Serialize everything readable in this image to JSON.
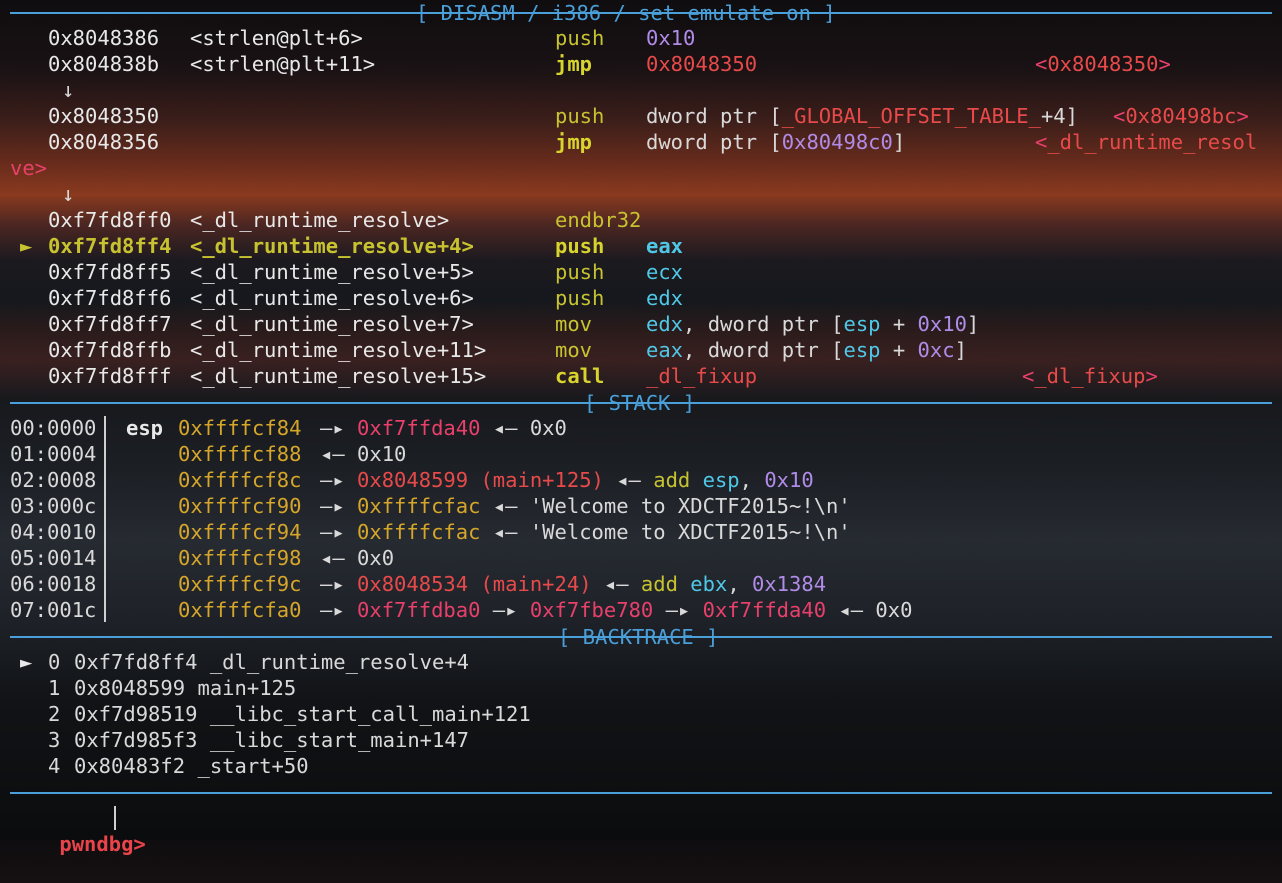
{
  "sections": {
    "disasm": "[ DISASM / i386 / set emulate on ]",
    "stack": "[ STACK ]",
    "backtrace": "[ BACKTRACE ]"
  },
  "disasm": [
    {
      "marker": "",
      "addr": "0x8048386",
      "sym": "<strlen@plt+6>",
      "op": "push",
      "args": "0x10",
      "comment": ""
    },
    {
      "marker": "",
      "addr": "0x804838b",
      "sym": "<strlen@plt+11>",
      "op": "jmp",
      "args": "0x8048350",
      "comment": "<0x8048350>"
    },
    {
      "arrow": "↓"
    },
    {
      "marker": "",
      "addr": "0x8048350",
      "sym": "",
      "op": "push",
      "args": "dword ptr [_GLOBAL_OFFSET_TABLE_+4]",
      "comment": "<0x80498bc>"
    },
    {
      "marker": "",
      "addr": "0x8048356",
      "sym": "",
      "op": "jmp",
      "args": "dword ptr [0x80498c0]",
      "comment": "<_dl_runtime_resol"
    },
    {
      "wrap": "ve>"
    },
    {
      "arrow": "↓"
    },
    {
      "marker": "",
      "addr": "0xf7fd8ff0",
      "sym": "<_dl_runtime_resolve>",
      "op": "endbr32",
      "args": "",
      "comment": ""
    },
    {
      "marker": "►",
      "addr": "0xf7fd8ff4",
      "sym": "<_dl_runtime_resolve+4>",
      "op": "push",
      "args": "eax",
      "comment": ""
    },
    {
      "marker": "",
      "addr": "0xf7fd8ff5",
      "sym": "<_dl_runtime_resolve+5>",
      "op": "push",
      "args": "ecx",
      "comment": ""
    },
    {
      "marker": "",
      "addr": "0xf7fd8ff6",
      "sym": "<_dl_runtime_resolve+6>",
      "op": "push",
      "args": "edx",
      "comment": ""
    },
    {
      "marker": "",
      "addr": "0xf7fd8ff7",
      "sym": "<_dl_runtime_resolve+7>",
      "op": "mov",
      "args": "edx, dword ptr [esp + 0x10]",
      "comment": ""
    },
    {
      "marker": "",
      "addr": "0xf7fd8ffb",
      "sym": "<_dl_runtime_resolve+11>",
      "op": "mov",
      "args": "eax, dword ptr [esp + 0xc]",
      "comment": ""
    },
    {
      "marker": "",
      "addr": "0xf7fd8fff",
      "sym": "<_dl_runtime_resolve+15>",
      "op": "call",
      "args": "_dl_fixup",
      "comment": "<_dl_fixup>"
    }
  ],
  "stack": [
    {
      "off": "00:0000",
      "reg": "esp",
      "addr": "0xffffcf84",
      "chain": [
        {
          "t": "—▸ ",
          "c": "gray"
        },
        {
          "t": "0xf7ffda40",
          "c": "pink"
        },
        {
          "t": " ◂— ",
          "c": "gray"
        },
        {
          "t": "0x0",
          "c": "gray"
        }
      ]
    },
    {
      "off": "01:0004",
      "reg": "",
      "addr": "0xffffcf88",
      "chain": [
        {
          "t": "◂— ",
          "c": "gray"
        },
        {
          "t": "0x10",
          "c": "gray"
        }
      ]
    },
    {
      "off": "02:0008",
      "reg": "",
      "addr": "0xffffcf8c",
      "chain": [
        {
          "t": "—▸ ",
          "c": "gray"
        },
        {
          "t": "0x8048599 (main+125)",
          "c": "red"
        },
        {
          "t": " ◂— ",
          "c": "gray"
        },
        {
          "t": "add ",
          "c": "op"
        },
        {
          "t": "esp",
          "c": "reg"
        },
        {
          "t": ", ",
          "c": "gray"
        },
        {
          "t": "0x10",
          "c": "num"
        }
      ]
    },
    {
      "off": "03:000c",
      "reg": "",
      "addr": "0xffffcf90",
      "chain": [
        {
          "t": "—▸ ",
          "c": "gray"
        },
        {
          "t": "0xffffcfac",
          "c": "stackaddr"
        },
        {
          "t": " ◂— ",
          "c": "gray"
        },
        {
          "t": "'Welcome to XDCTF2015~!\\n'",
          "c": "gray"
        }
      ]
    },
    {
      "off": "04:0010",
      "reg": "",
      "addr": "0xffffcf94",
      "chain": [
        {
          "t": "—▸ ",
          "c": "gray"
        },
        {
          "t": "0xffffcfac",
          "c": "stackaddr"
        },
        {
          "t": " ◂— ",
          "c": "gray"
        },
        {
          "t": "'Welcome to XDCTF2015~!\\n'",
          "c": "gray"
        }
      ]
    },
    {
      "off": "05:0014",
      "reg": "",
      "addr": "0xffffcf98",
      "chain": [
        {
          "t": "◂— ",
          "c": "gray"
        },
        {
          "t": "0x0",
          "c": "gray"
        }
      ]
    },
    {
      "off": "06:0018",
      "reg": "",
      "addr": "0xffffcf9c",
      "chain": [
        {
          "t": "—▸ ",
          "c": "gray"
        },
        {
          "t": "0x8048534 (main+24)",
          "c": "red"
        },
        {
          "t": " ◂— ",
          "c": "gray"
        },
        {
          "t": "add ",
          "c": "op"
        },
        {
          "t": "ebx",
          "c": "reg"
        },
        {
          "t": ", ",
          "c": "gray"
        },
        {
          "t": "0x1384",
          "c": "num"
        }
      ]
    },
    {
      "off": "07:001c",
      "reg": "",
      "addr": "0xffffcfa0",
      "chain": [
        {
          "t": "—▸ ",
          "c": "gray"
        },
        {
          "t": "0xf7ffdba0",
          "c": "pink"
        },
        {
          "t": " —▸ ",
          "c": "gray"
        },
        {
          "t": "0xf7fbe780",
          "c": "pink"
        },
        {
          "t": " —▸ ",
          "c": "gray"
        },
        {
          "t": "0xf7ffda40",
          "c": "pink"
        },
        {
          "t": " ◂— ",
          "c": "gray"
        },
        {
          "t": "0x0",
          "c": "gray"
        }
      ]
    }
  ],
  "backtrace": [
    {
      "marker": "►",
      "idx": "0",
      "addr": "0xf7fd8ff4",
      "sym": "_dl_runtime_resolve+4"
    },
    {
      "marker": "",
      "idx": "1",
      "addr": "0x8048599",
      "sym": "main+125"
    },
    {
      "marker": "",
      "idx": "2",
      "addr": "0xf7d98519",
      "sym": "__libc_start_call_main+121"
    },
    {
      "marker": "",
      "idx": "3",
      "addr": "0xf7d985f3",
      "sym": "__libc_start_main+147"
    },
    {
      "marker": "",
      "idx": "4",
      "addr": "0x80483f2",
      "sym": "_start+50"
    }
  ],
  "prompt": "pwndbg>",
  "colors": {
    "separator": "#4a9fd8",
    "current_line": "#c7c330",
    "opcode": "#c7c330",
    "register": "#4fc8e8",
    "number": "#b08ce8",
    "code_pointer": "#e84a4a",
    "heap_pointer": "#e8406a",
    "stack_pointer": "#d6a62a",
    "prompt": "#e8444a"
  }
}
